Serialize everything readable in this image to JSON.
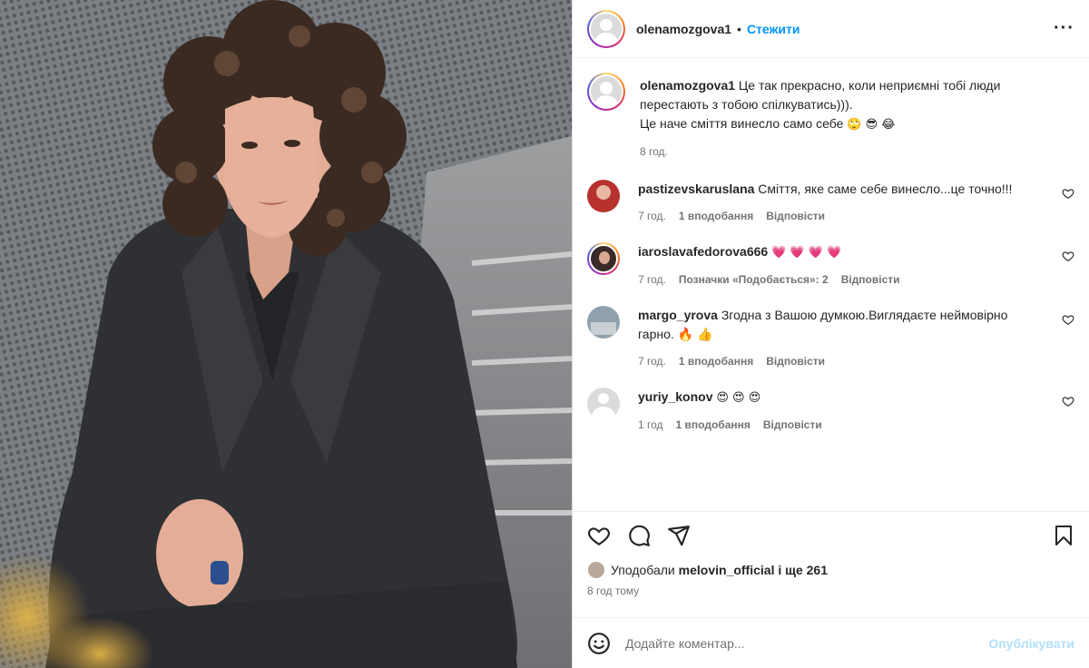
{
  "post": {
    "username": "olenamozgova1",
    "dot": "•",
    "follow_label": "Стежити",
    "more_label": "···",
    "caption_text": "Це так прекрасно, коли неприємні тобі люди перестають з тобою спілкуватись))).",
    "caption_line2": "Це наче сміття винесло само себе",
    "caption_emojis": "🙄 😎 😂",
    "caption_time": "8 год."
  },
  "comments": [
    {
      "username": "pastizevskaruslana",
      "text": "Сміття, яке саме себе винесло...це точно!!!",
      "time": "7 год.",
      "likes": "1 вподобання",
      "reply": "Відповісти",
      "avatar_color": "#b7322e"
    },
    {
      "username": "iaroslavafedorova666",
      "text": "💗 💗 💗 💗",
      "time": "7 год.",
      "likes": "Позначки «Подобається»: 2",
      "reply": "Відповісти",
      "avatar_color": "#3a2b28"
    },
    {
      "username": "margo_yrova",
      "text": "Згодна з Вашою думкою.Виглядаєте неймовірно гарно. 🔥 👍",
      "time": "7 год.",
      "likes": "1 вподобання",
      "reply": "Відповісти",
      "avatar_color": "#8fa1ad"
    },
    {
      "username": "yuriy_konov",
      "text": "😍 😍 😍",
      "time": "1 год",
      "likes": "1 вподобання",
      "reply": "Відповісти",
      "avatar_color": "#dbdbdb"
    }
  ],
  "likes": {
    "prefix": "Уподобали",
    "user": "melovin_official",
    "suffix": "і ще 261"
  },
  "posted_ago": "8 год тому",
  "comment_box": {
    "placeholder": "Додайте коментар...",
    "post_label": "Опублікувати"
  },
  "icons": [
    "heart-icon",
    "comment-icon",
    "share-icon",
    "bookmark-icon",
    "emoji-icon",
    "more-icon"
  ]
}
